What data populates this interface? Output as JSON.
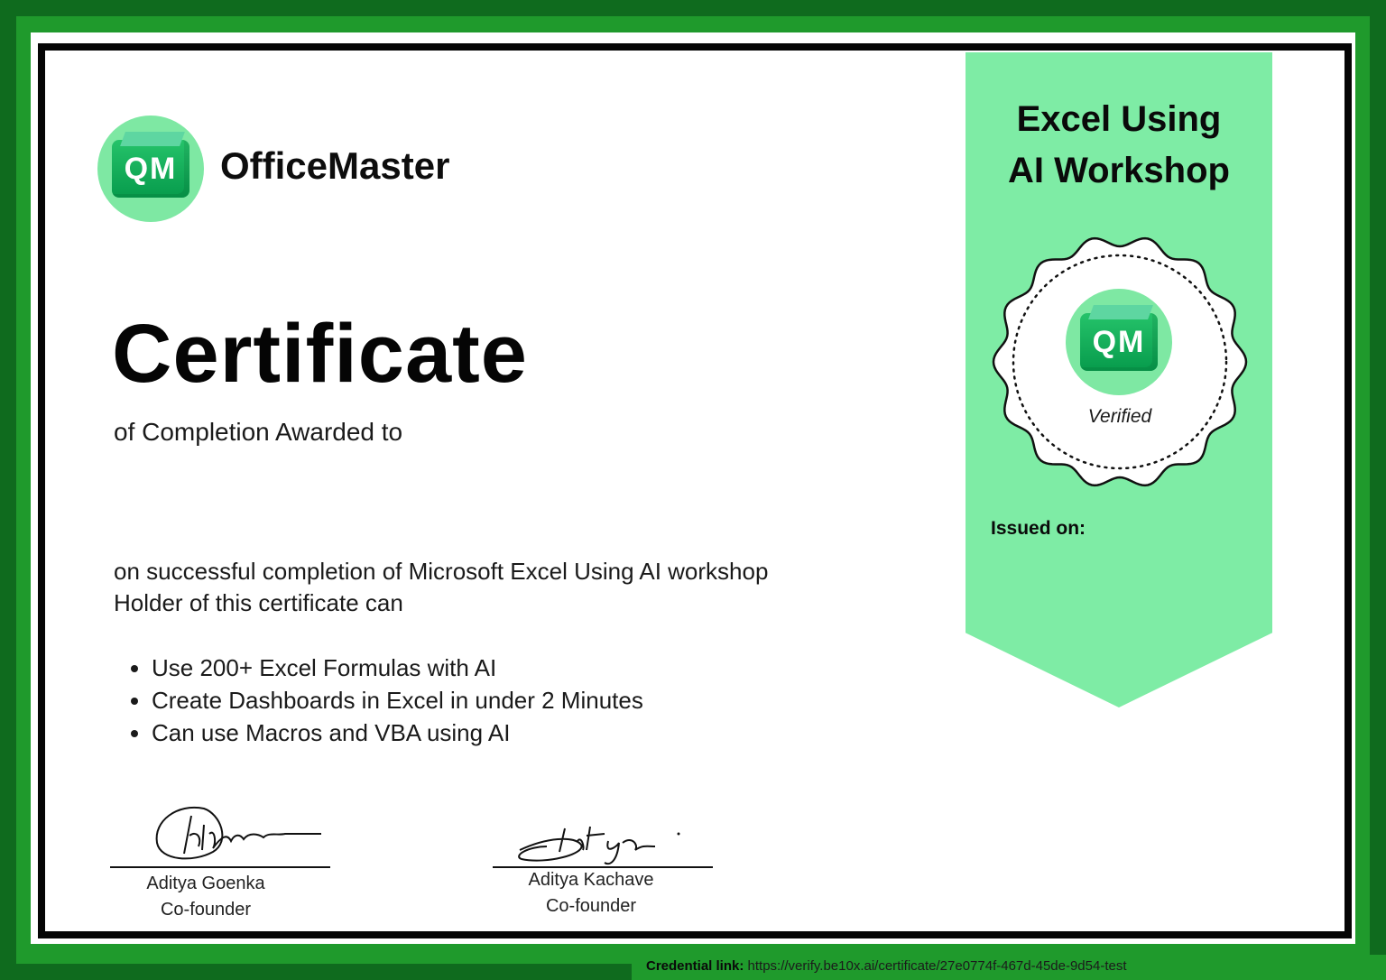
{
  "brand": {
    "logo_initials": "QM",
    "name": "OfficeMaster",
    "logo_color": "#08a04e",
    "circle_color": "#7ee8a3"
  },
  "certificate": {
    "title": "Certificate",
    "subtitle": "of Completion Awarded to",
    "completion_line": "on successful completion of Microsoft Excel Using AI workshop",
    "holder_line": "Holder of this certificate can",
    "skills": [
      "Use 200+ Excel Formulas with AI",
      "Create Dashboards in Excel in under 2 Minutes",
      "Can use Macros and VBA using AI"
    ]
  },
  "signatures": [
    {
      "name": "Aditya Goenka",
      "role": "Co-founder"
    },
    {
      "name": "Aditya Kachave",
      "role": "Co-founder"
    }
  ],
  "ribbon": {
    "title_line1": "Excel Using",
    "title_line2": "AI Workshop",
    "seal_initials": "QM",
    "seal_text": "Verified",
    "issued_label": "Issued on:",
    "color": "#7eeca5"
  },
  "credential": {
    "label": "Credential link:",
    "url": "https://verify.be10x.ai/certificate/27e0774f-467d-45de-9d54-test"
  },
  "colors": {
    "outer_frame": "#0f6b1e",
    "inner_band": "#1f9a2c",
    "border": "#050505"
  }
}
